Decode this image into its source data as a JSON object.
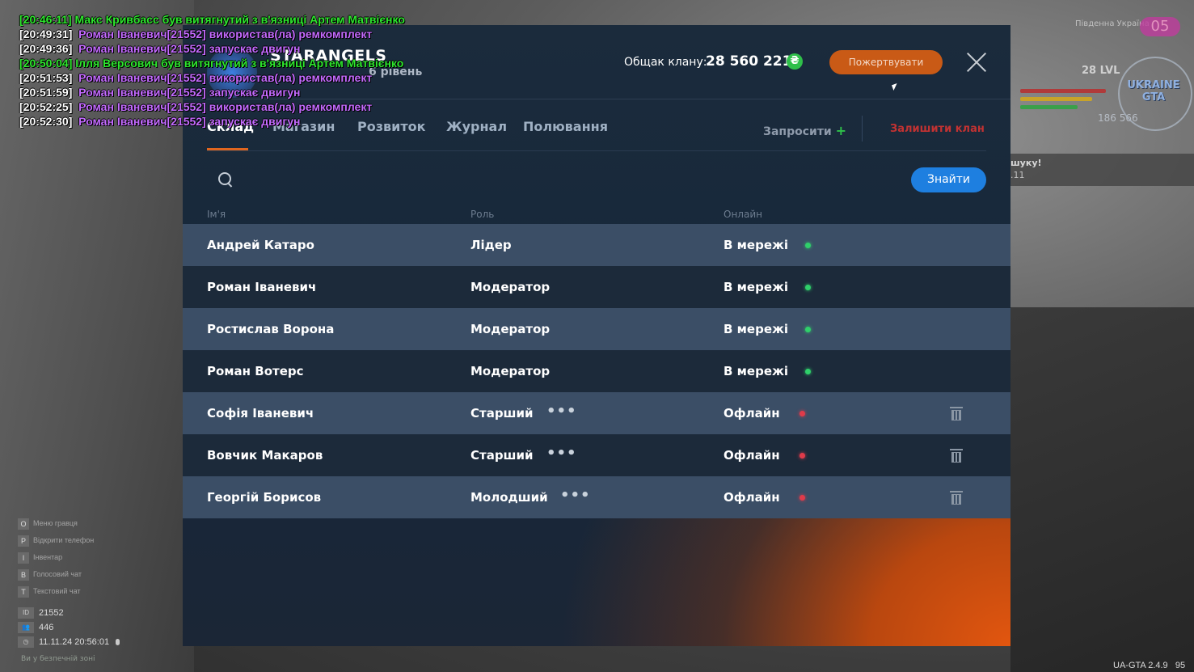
{
  "chat": [
    {
      "time": "[20:46:11]",
      "text": "Макс Кривбасс був витягнутий з в'язниці Артем Матвієнко",
      "color": "green"
    },
    {
      "time": "[20:49:31]",
      "text": "Роман Іваневич[21552] використав(ла) ремкомплект",
      "color": "purple"
    },
    {
      "time": "[20:49:36]",
      "text": "Роман Іваневич[21552] запускає двигун",
      "color": "purple"
    },
    {
      "time": "[20:50:04]",
      "text": "Ілля Версович був витягнутий з в'язниці Артем Матвієнко",
      "color": "green"
    },
    {
      "time": "[20:51:53]",
      "text": "Роман Іваневич[21552] використав(ла) ремкомплект",
      "color": "purple"
    },
    {
      "time": "[20:51:59]",
      "text": "Роман Іваневич[21552] запускає двигун",
      "color": "purple"
    },
    {
      "time": "[20:52:25]",
      "text": "Роман Іваневич[21552] використав(ла) ремкомплект",
      "color": "purple"
    },
    {
      "time": "[20:52:30]",
      "text": "Роман Іваневич[21552] запускає двигун",
      "color": "purple"
    }
  ],
  "clan": {
    "name": "STARANGELS",
    "level": "6 рівень",
    "total_label": "Общак клану:",
    "total_value": "28 560 221",
    "currency_symbol": "₴",
    "donate_label": "Пожертвувати"
  },
  "tabs": [
    {
      "label": "Склад",
      "active": true
    },
    {
      "label": "Магазин",
      "active": false
    },
    {
      "label": "Розвиток",
      "active": false
    },
    {
      "label": "Журнал",
      "active": false
    },
    {
      "label": "Полювання",
      "active": false
    }
  ],
  "actions": {
    "invite_label": "Запросити",
    "invite_plus": "+",
    "leave_label": "Залишити клан"
  },
  "search": {
    "placeholder": "",
    "button_label": "Знайти"
  },
  "columns": {
    "name": "Ім'я",
    "role": "Роль",
    "online": "Онлайн"
  },
  "members": [
    {
      "name": "Андрей Катаро",
      "role": "Лідер",
      "status": "В мережі",
      "online": true,
      "menu": false,
      "delete": false
    },
    {
      "name": "Роман Іваневич",
      "role": "Модератор",
      "status": "В мережі",
      "online": true,
      "menu": false,
      "delete": false
    },
    {
      "name": "Ростислав Ворона",
      "role": "Модератор",
      "status": "В мережі",
      "online": true,
      "menu": false,
      "delete": false
    },
    {
      "name": "Роман Вотерс",
      "role": "Модератор",
      "status": "В мережі",
      "online": true,
      "menu": false,
      "delete": false
    },
    {
      "name": "Софія Іваневич",
      "role": "Старший",
      "status": "Офлайн",
      "online": false,
      "menu": true,
      "delete": true
    },
    {
      "name": "Вовчик Макаров",
      "role": "Старший",
      "status": "Офлайн",
      "online": false,
      "menu": true,
      "delete": true
    },
    {
      "name": "Георгій Борисов",
      "role": "Молодший",
      "status": "Офлайн",
      "online": false,
      "menu": true,
      "delete": true
    }
  ],
  "hud": {
    "zone": "Південна Україна",
    "hour": "05",
    "level": "28 LVL",
    "money": "186 566",
    "notice_title": "шукy!",
    "notice_sub": ".11",
    "server_logo": "UKRAINE GTA",
    "watermark": "UKRAINE GTA",
    "keys": [
      {
        "key": "O",
        "label": "Меню гравця"
      },
      {
        "key": "P",
        "label": "Відкрити телефон"
      },
      {
        "key": "I",
        "label": "Інвентар"
      },
      {
        "key": "B",
        "label": "Голосовий чат"
      },
      {
        "key": "T",
        "label": "Текстовий чат"
      }
    ],
    "id_tag": "ID",
    "id_value": "21552",
    "players_tag": "👥",
    "players_value": "446",
    "datetime": "11.11.24 20:56:01",
    "safe_zone": "Ви у безпечній зоні",
    "version": "UA-GTA 2.4.9",
    "fps": "95"
  },
  "colors": {
    "accent_orange": "#c95a16",
    "find_blue": "#1e7fe0",
    "online_green": "#2fd06a",
    "offline_red": "#e03b4a",
    "leave_red": "#c23232"
  }
}
